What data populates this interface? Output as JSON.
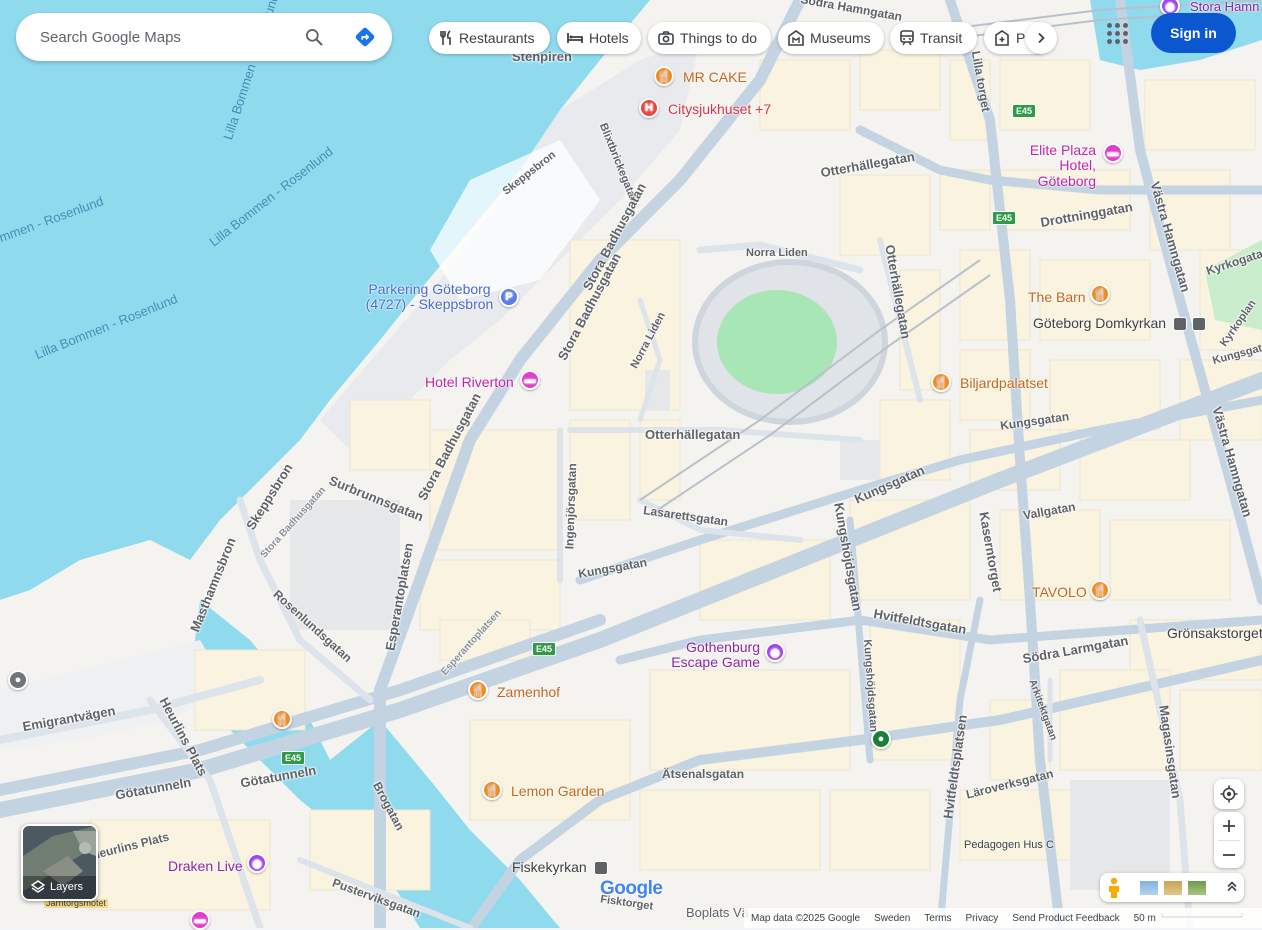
{
  "search": {
    "placeholder": "Search Google Maps"
  },
  "chips": [
    {
      "label": "Restaurants",
      "icon": "fork-knife-icon"
    },
    {
      "label": "Hotels",
      "icon": "bed-icon"
    },
    {
      "label": "Things to do",
      "icon": "camera-icon"
    },
    {
      "label": "Museums",
      "icon": "museum-icon"
    },
    {
      "label": "Transit",
      "icon": "train-icon"
    },
    {
      "label": "Pharmacies",
      "icon": "pharmacy-icon"
    }
  ],
  "header": {
    "signin_label": "Sign in"
  },
  "map": {
    "water_labels": [
      "Lilla Bommen - Rosenlund",
      "Lilla Bommen - Rosenlund",
      "Lilla Bommen - Rosenlund",
      "Lilla Bommen - Rosenlund"
    ],
    "streets": [
      "Stenpiren",
      "Skeppsbron",
      "Blixtbrickegatan",
      "Stora Badhusgatan",
      "Stora Badhusgatan",
      "Stora Badhusgatan",
      "Norra Liden",
      "Norra Liden",
      "Otterhällegatan",
      "Otterhällegatan",
      "Otterhällegatan",
      "Surbrunnsgatan",
      "Skeppsbron",
      "Stora Badhusgatan",
      "Ingenjörsgatan",
      "Lasarettsgatan",
      "Kungsgatan",
      "Kungsgatan",
      "Kungshöjdsgatan",
      "Kaserntorget",
      "Masthamnsbron",
      "Rosenlundsgatan",
      "Esperantoplatsen",
      "Esperantoplatsen",
      "Hvitfeldtsgatan",
      "Södra Larmgatan",
      "Magasinsgatan",
      "Kungshöjdsgatan",
      "Arkitektgatan",
      "Emigrantvägen",
      "Heurlins Plats",
      "Götatunneln",
      "Götatunneln",
      "Ätsenalsgatan",
      "Hvitfeldtsplatsen",
      "Läroverksgatan",
      "Brogatan",
      "Pusterviksgatan",
      "Fisktorget",
      "Västra Hamngatan",
      "Västra Hamngatan",
      "Drottninggatan",
      "Kungsgatan",
      "Vallgatan",
      "Lilla torget",
      "Kyrkogatan",
      "Kyrkoplan",
      "Kungsgatan",
      "Stora Hamn",
      "Södra Hamngatan",
      "Heurlins Plats",
      "Järntorgsmotet"
    ],
    "pois": {
      "mr_cake": "MR CAKE",
      "citysjukhuset": "Citysjukhuset +7",
      "elite_plaza": "Elite Plaza Hotel, Göteborg",
      "the_barn": "The Barn",
      "domkyrkan": "Göteborg Domkyrkan",
      "parkering": "Parkering Göteborg (4727) - Skeppsbron",
      "hotel_riverton": "Hotel Riverton",
      "biljardpalatset": "Biljardpalatset",
      "tavolo": "TAVOLO",
      "gronsakstorget": "Grönsakstorget",
      "gothenburg_escape": "Gothenburg Escape Game",
      "zamenhof": "Zamenhof",
      "lemon_garden": "Lemon Garden",
      "draken_live": "Draken Live",
      "fiskekyrkan": "Fiskekyrkan",
      "pedagogen": "Pedagogen Hus C",
      "boplats": "Boplats Vä"
    },
    "shield": "E45",
    "google_logo": "Google"
  },
  "controls": {
    "layers_label": "Layers"
  },
  "footer": {
    "map_data": "Map data ©2025 Google",
    "country": "Sweden",
    "terms": "Terms",
    "privacy": "Privacy",
    "feedback": "Send Product Feedback",
    "scale": "50 m"
  }
}
